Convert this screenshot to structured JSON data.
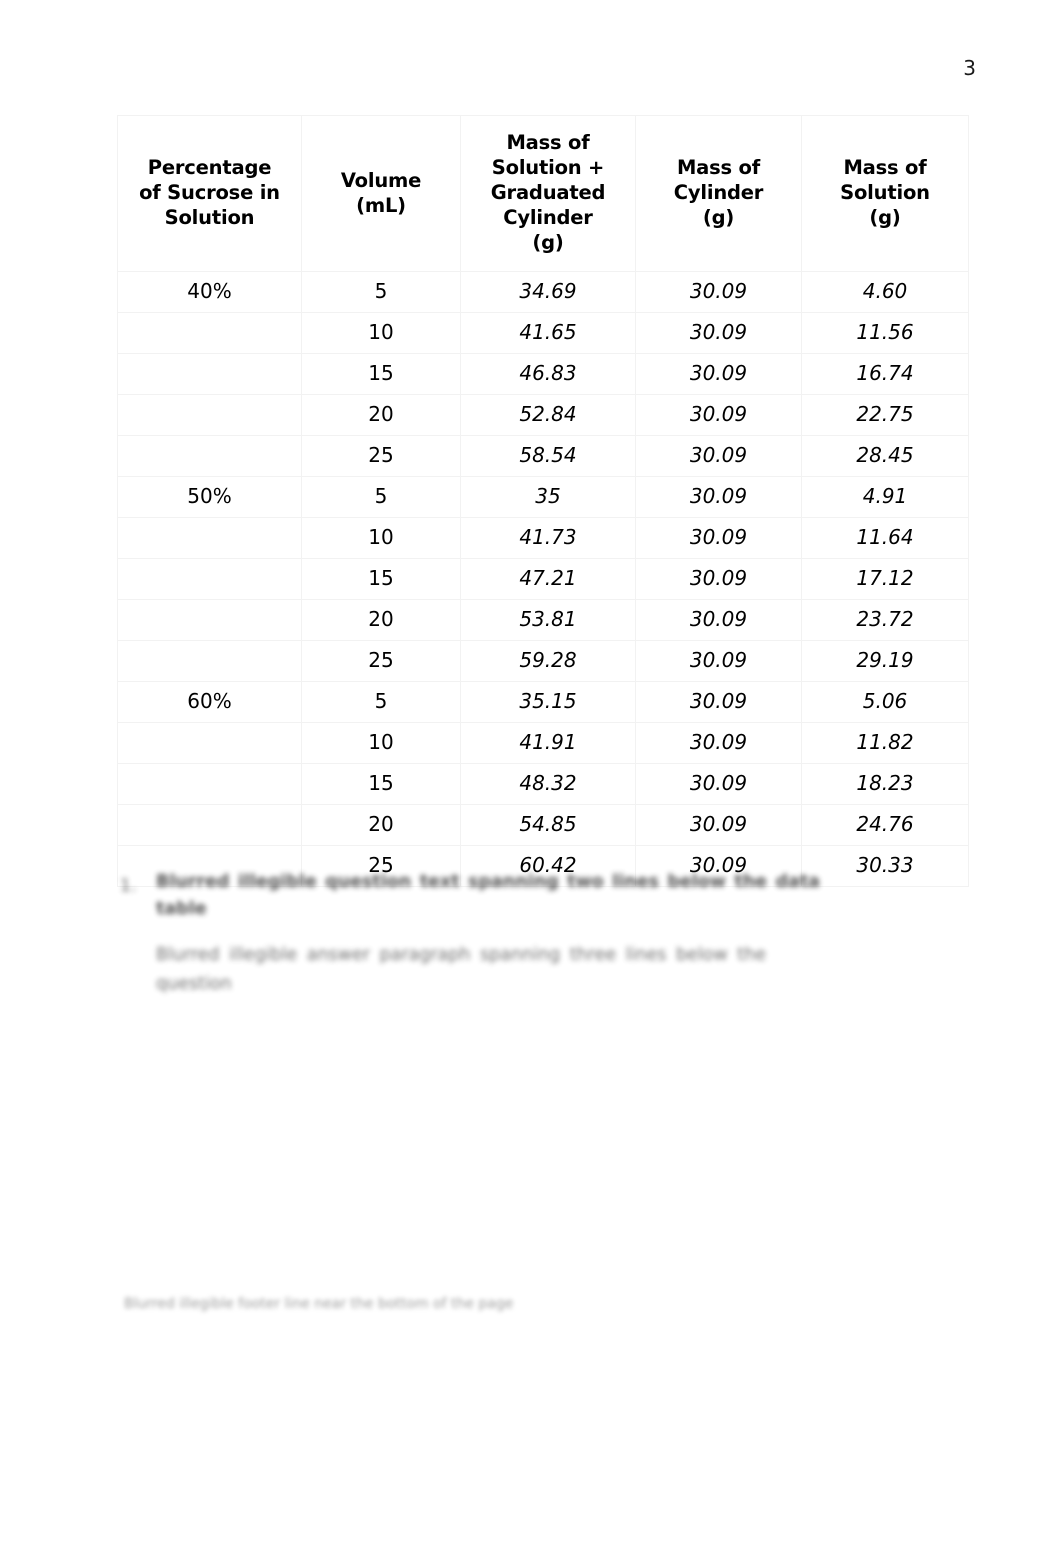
{
  "page": {
    "number": "3",
    "background_color": "#ffffff"
  },
  "colors": {
    "value_blue": "#2E74B5",
    "header_text": "#000000",
    "table_border": "#f2f2f2"
  },
  "table": {
    "headers": [
      "Percentage\nof Sucrose in\nSolution",
      "Volume\n(mL)",
      "Mass of\nSolution +\nGraduated\nCylinder\n(g)",
      "Mass of\nCylinder\n(g)",
      "Mass of\nSolution\n(g)"
    ],
    "header_lines": [
      [
        "Percentage",
        "of Sucrose in",
        "Solution"
      ],
      [
        "Volume",
        "(mL)"
      ],
      [
        "Mass of",
        "Solution +",
        "Graduated",
        "Cylinder",
        "(g)"
      ],
      [
        "Mass of",
        "Cylinder",
        "(g)"
      ],
      [
        "Mass of",
        "Solution",
        "(g)"
      ]
    ],
    "rows": [
      {
        "percentage": "40%",
        "volume": "5",
        "mass_solution_plus_cylinder": "34.69",
        "mass_cylinder": "30.09",
        "mass_solution": "4.60"
      },
      {
        "percentage": "",
        "volume": "10",
        "mass_solution_plus_cylinder": "41.65",
        "mass_cylinder": "30.09",
        "mass_solution": "11.56"
      },
      {
        "percentage": "",
        "volume": "15",
        "mass_solution_plus_cylinder": "46.83",
        "mass_cylinder": "30.09",
        "mass_solution": "16.74"
      },
      {
        "percentage": "",
        "volume": "20",
        "mass_solution_plus_cylinder": "52.84",
        "mass_cylinder": "30.09",
        "mass_solution": "22.75"
      },
      {
        "percentage": "",
        "volume": "25",
        "mass_solution_plus_cylinder": "58.54",
        "mass_cylinder": "30.09",
        "mass_solution": "28.45"
      },
      {
        "percentage": "50%",
        "volume": "5",
        "mass_solution_plus_cylinder": "35",
        "mass_cylinder": "30.09",
        "mass_solution": "4.91"
      },
      {
        "percentage": "",
        "volume": "10",
        "mass_solution_plus_cylinder": "41.73",
        "mass_cylinder": "30.09",
        "mass_solution": "11.64"
      },
      {
        "percentage": "",
        "volume": "15",
        "mass_solution_plus_cylinder": "47.21",
        "mass_cylinder": "30.09",
        "mass_solution": "17.12"
      },
      {
        "percentage": "",
        "volume": "20",
        "mass_solution_plus_cylinder": "53.81",
        "mass_cylinder": "30.09",
        "mass_solution": "23.72"
      },
      {
        "percentage": "",
        "volume": "25",
        "mass_solution_plus_cylinder": "59.28",
        "mass_cylinder": "30.09",
        "mass_solution": "29.19"
      },
      {
        "percentage": "60%",
        "volume": "5",
        "mass_solution_plus_cylinder": "35.15",
        "mass_cylinder": "30.09",
        "mass_solution": "5.06"
      },
      {
        "percentage": "",
        "volume": "10",
        "mass_solution_plus_cylinder": "41.91",
        "mass_cylinder": "30.09",
        "mass_solution": "11.82"
      },
      {
        "percentage": "",
        "volume": "15",
        "mass_solution_plus_cylinder": "48.32",
        "mass_cylinder": "30.09",
        "mass_solution": "18.23"
      },
      {
        "percentage": "",
        "volume": "20",
        "mass_solution_plus_cylinder": "54.85",
        "mass_cylinder": "30.09",
        "mass_solution": "24.76"
      },
      {
        "percentage": "",
        "volume": "25",
        "mass_solution_plus_cylinder": "60.42",
        "mass_cylinder": "30.09",
        "mass_solution": "30.33"
      }
    ]
  },
  "prose": {
    "question_marker": "1.",
    "question_text": "Blurred illegible question text spanning two lines below the data table",
    "answer_text": "Blurred illegible answer paragraph spanning three lines below the question",
    "footer_text": "Blurred illegible footer line near the bottom of the page"
  }
}
